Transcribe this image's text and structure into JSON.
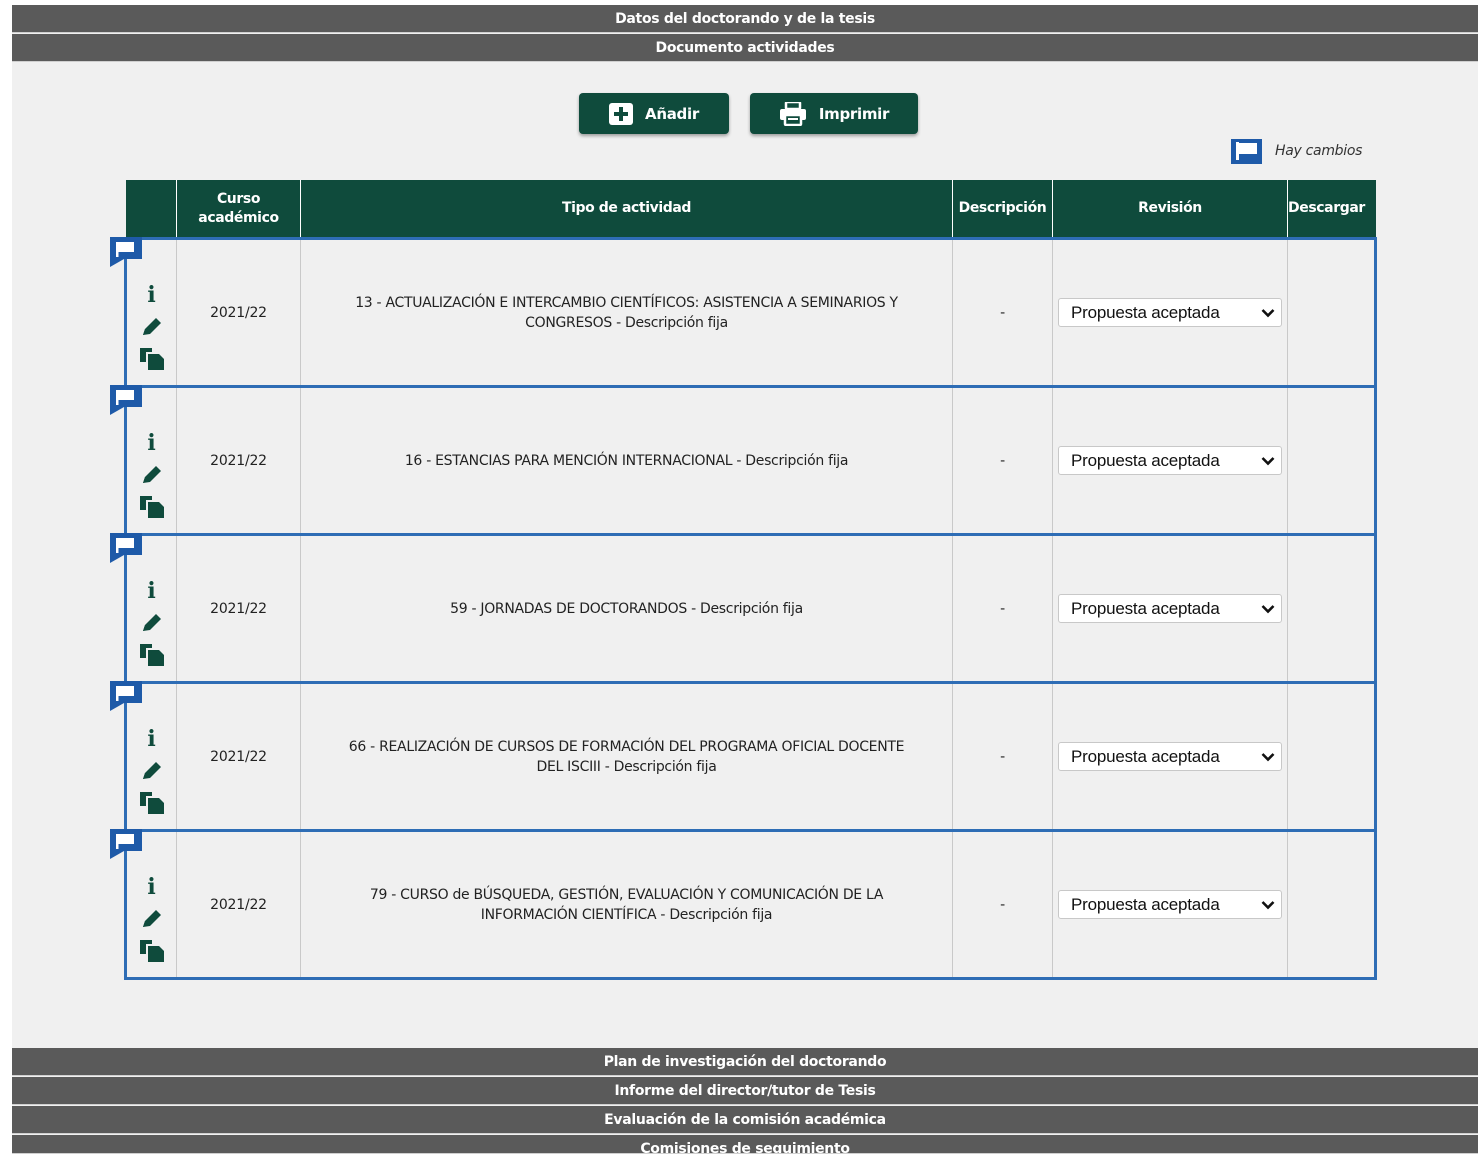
{
  "sections_top": [
    {
      "label": "Datos del doctorando y de la tesis"
    },
    {
      "label": "Documento actividades"
    }
  ],
  "toolbar": {
    "add_label": "Añadir",
    "print_label": "Imprimir",
    "add_icon": "plus-square-icon",
    "print_icon": "printer-icon"
  },
  "legend": {
    "icon": "flag-icon",
    "label": "Hay cambios",
    "color": "#1e5aa8"
  },
  "table": {
    "headers": {
      "curso_line1": "Curso",
      "curso_line2": "académico",
      "tipo": "Tipo de actividad",
      "descripcion": "Descripción",
      "revision": "Revisión",
      "descargar": "Descargar"
    },
    "row_icons": [
      "flag-icon",
      "info-icon",
      "pencil-icon",
      "copy-icon"
    ],
    "rows": [
      {
        "curso": "2021/22",
        "tipo_line1": "13 - ACTUALIZACIÓN E INTERCAMBIO CIENTÍFICOS: ASISTENCIA A SEMINARIOS Y",
        "tipo_line2": "CONGRESOS - Descripción fija",
        "descripcion": "-",
        "revision": "Propuesta aceptada",
        "descargar": ""
      },
      {
        "curso": "2021/22",
        "tipo_line1": "16 - ESTANCIAS PARA MENCIÓN INTERNACIONAL - Descripción fija",
        "tipo_line2": "",
        "descripcion": "-",
        "revision": "Propuesta aceptada",
        "descargar": ""
      },
      {
        "curso": "2021/22",
        "tipo_line1": "59 - JORNADAS DE DOCTORANDOS - Descripción fija",
        "tipo_line2": "",
        "descripcion": "-",
        "revision": "Propuesta aceptada",
        "descargar": ""
      },
      {
        "curso": "2021/22",
        "tipo_line1": "66 - REALIZACIÓN DE CURSOS DE FORMACIÓN DEL PROGRAMA OFICIAL DOCENTE",
        "tipo_line2": "DEL ISCIII - Descripción fija",
        "descripcion": "-",
        "revision": "Propuesta aceptada",
        "descargar": ""
      },
      {
        "curso": "2021/22",
        "tipo_line1": "79 - CURSO de BÚSQUEDA, GESTIÓN, EVALUACIÓN Y COMUNICACIÓN DE LA",
        "tipo_line2": "INFORMACIÓN CIENTÍFICA - Descripción fija",
        "descripcion": "-",
        "revision": "Propuesta aceptada",
        "descargar": ""
      }
    ]
  },
  "sections_bottom": [
    {
      "label": "Plan de investigación del doctorando"
    },
    {
      "label": "Informe del director/tutor de Tesis"
    },
    {
      "label": "Evaluación de la comisión académica"
    },
    {
      "label": "Comisiones de seguimiento"
    }
  ],
  "colors": {
    "primary": "#0f4b3c",
    "section_bar": "#5a5a5a",
    "row_border": "#2e6db5",
    "flag": "#1e5aa8",
    "panel_bg": "#f0f0f0"
  }
}
